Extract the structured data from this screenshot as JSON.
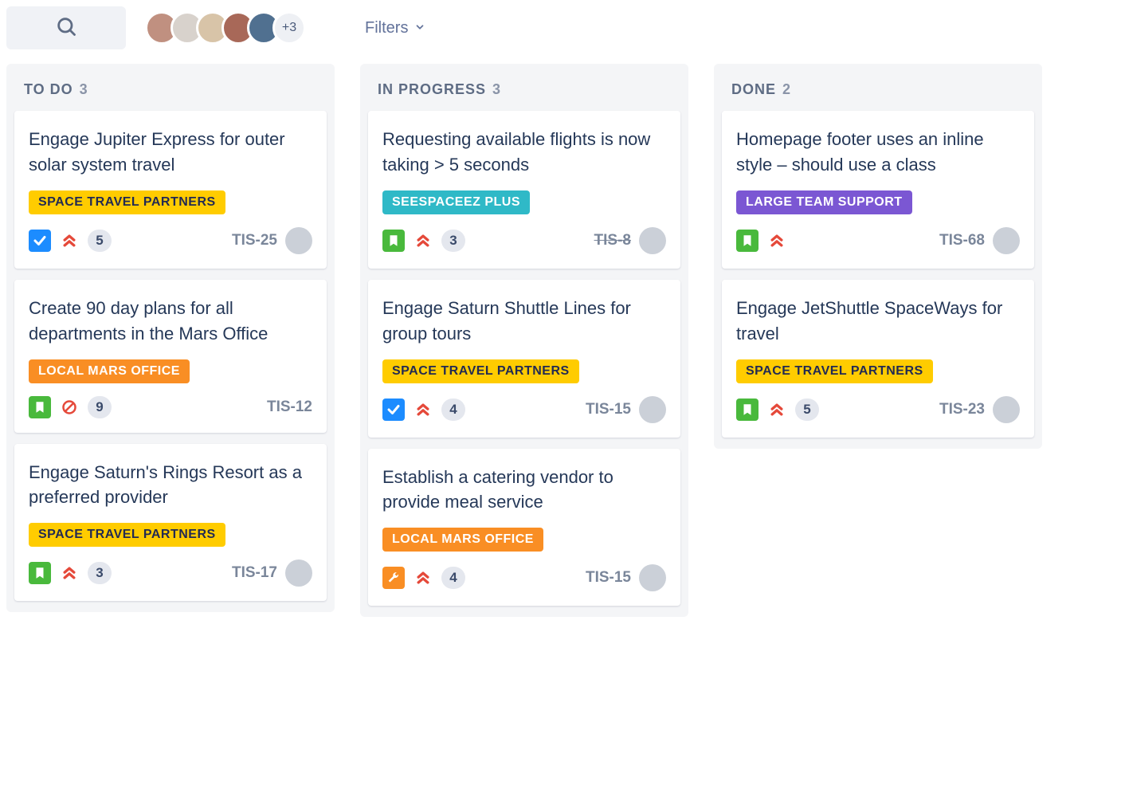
{
  "toolbar": {
    "search_placeholder": "",
    "filters_label": "Filters",
    "avatar_extra": "+3"
  },
  "icons": {
    "task": "checkbox-task-icon",
    "story": "bookmark-story-icon",
    "wrench": "wrench-subtask-icon",
    "priority_highest": "priority-highest-icon",
    "priority_blocker": "priority-blocker-icon",
    "priority_up": "priority-up-icon"
  },
  "tag_colors": {
    "SPACE TRAVEL PARTNERS": "yellow",
    "LOCAL MARS OFFICE": "orange",
    "SEESPACEEZ PLUS": "teal",
    "LARGE TEAM SUPPORT": "purple"
  },
  "columns": [
    {
      "title": "TO DO",
      "count": "3",
      "cards": [
        {
          "title": "Engage Jupiter Express for outer solar system travel",
          "tag": "SPACE TRAVEL PARTNERS",
          "type": "task",
          "priority": "highest",
          "points": "5",
          "key": "TIS-25",
          "key_done": false,
          "assignee": true
        },
        {
          "title": "Create 90 day plans for all departments in the Mars Office",
          "tag": "LOCAL MARS OFFICE",
          "type": "story",
          "priority": "blocker",
          "points": "9",
          "key": "TIS-12",
          "key_done": false,
          "assignee": false
        },
        {
          "title": "Engage Saturn's Rings Resort as a preferred provider",
          "tag": "SPACE TRAVEL PARTNERS",
          "type": "story",
          "priority": "highest",
          "points": "3",
          "key": "TIS-17",
          "key_done": false,
          "assignee": true
        }
      ]
    },
    {
      "title": "IN PROGRESS",
      "count": "3",
      "cards": [
        {
          "title": "Requesting available flights is now taking > 5 seconds",
          "tag": "SEESPACEEZ PLUS",
          "type": "story",
          "priority": "highest",
          "points": "3",
          "key": "TIS-8",
          "key_done": true,
          "assignee": true
        },
        {
          "title": "Engage Saturn Shuttle Lines for group tours",
          "tag": "SPACE TRAVEL PARTNERS",
          "type": "task",
          "priority": "highest",
          "points": "4",
          "key": "TIS-15",
          "key_done": false,
          "assignee": true
        },
        {
          "title": "Establish a catering vendor to provide meal service",
          "tag": "LOCAL MARS OFFICE",
          "type": "wrench",
          "priority": "highest",
          "points": "4",
          "key": "TIS-15",
          "key_done": false,
          "assignee": true
        }
      ]
    },
    {
      "title": "DONE",
      "count": "2",
      "cards": [
        {
          "title": "Homepage footer uses an inline style – should use a class",
          "tag": "LARGE TEAM SUPPORT",
          "type": "story",
          "priority": "highest",
          "points": "",
          "key": "TIS-68",
          "key_done": false,
          "assignee": true
        },
        {
          "title": "Engage JetShuttle SpaceWays for travel",
          "tag": "SPACE TRAVEL PARTNERS",
          "type": "story",
          "priority": "highest",
          "points": "5",
          "key": "TIS-23",
          "key_done": false,
          "assignee": true
        }
      ]
    }
  ]
}
